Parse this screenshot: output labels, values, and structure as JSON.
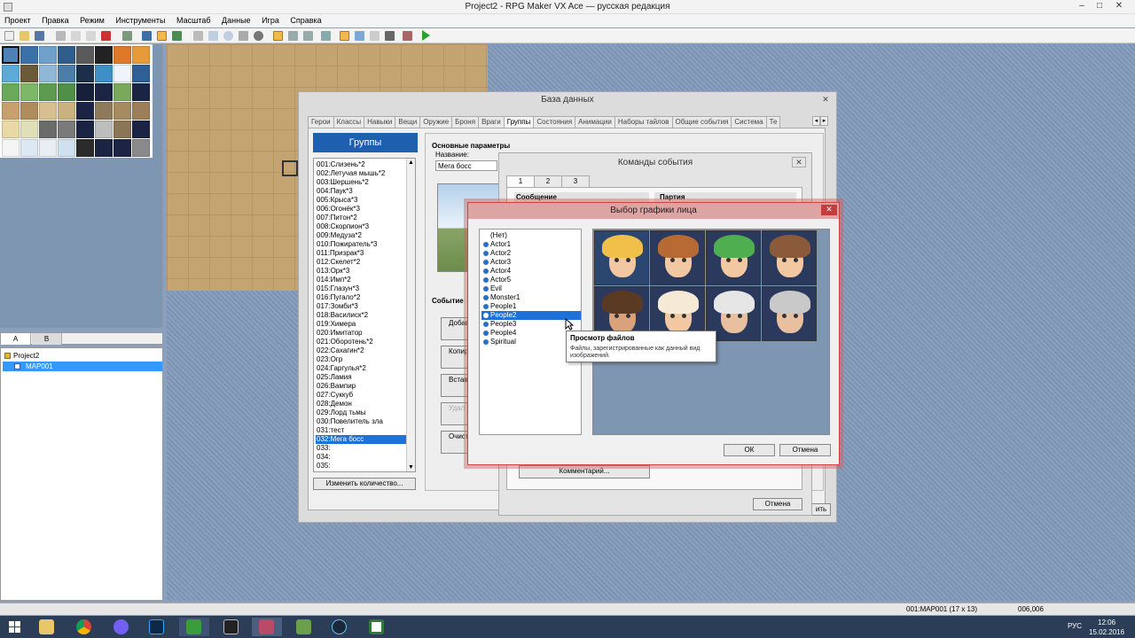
{
  "window": {
    "title": "Project2 - RPG Maker VX Ace — русская редакция",
    "minimize": "–",
    "maximize": "□",
    "close": "✕"
  },
  "menu": [
    "Проект",
    "Правка",
    "Режим",
    "Инструменты",
    "Масштаб",
    "Данные",
    "Игра",
    "Справка"
  ],
  "layer_tabs": [
    "A",
    "B"
  ],
  "tree": {
    "project": "Project2",
    "map": "MAP001"
  },
  "status": {
    "map": "001:MAP001 (17 x 13)",
    "coords": "006,006"
  },
  "taskbar": {
    "lang": "РУС",
    "time": "12:06",
    "date": "15.02.2016"
  },
  "database": {
    "title": "База данных",
    "tabs": [
      "Герои",
      "Классы",
      "Навыки",
      "Вещи",
      "Оружие",
      "Броня",
      "Враги",
      "Группы",
      "Состояния",
      "Анимации",
      "Наборы тайлов",
      "Общие события",
      "Система",
      "Те"
    ],
    "active_tab": "Группы",
    "groups_header": "Группы",
    "groups": [
      "001:Слизень*2",
      "002:Летучая мышь*2",
      "003:Шершень*2",
      "004:Паук*3",
      "005:Крыса*3",
      "006:Огонёк*3",
      "007:Питон*2",
      "008:Скорпион*3",
      "009:Медуза*2",
      "010:Пожиратель*3",
      "011:Призрак*3",
      "012:Скелет*2",
      "013:Орк*3",
      "014:Имп*2",
      "015:Глазун*3",
      "016:Пугало*2",
      "017:Зомби*3",
      "018:Василиск*2",
      "019:Химера",
      "020:Имитатор",
      "021:Оборотень*2",
      "022:Сахагин*2",
      "023:Огр",
      "024:Гаргулья*2",
      "025:Ламия",
      "026:Вампир",
      "027:Суккуб",
      "028:Демон",
      "029:Лорд тьмы",
      "030:Повелитель зла",
      "031:тест",
      "032:Мега босс",
      "033:",
      "034:",
      "035:"
    ],
    "selected_group": "032:Мега босс",
    "change_count_btn": "Изменить количество...",
    "basic_params": "Основные параметры",
    "name_label": "Название:",
    "name_value": "Мега босс",
    "event_label": "Событие",
    "side_buttons": [
      "Добав страни",
      "Копир страни",
      "Встав страни",
      "Удал страни",
      "Очист страни"
    ],
    "apply_fragment": "ить"
  },
  "event_commands": {
    "title": "Команды события",
    "tabs": [
      "1",
      "2",
      "3"
    ],
    "message_label": "Сообщение",
    "party_label": "Партия",
    "comment_btn": "Комментарий...",
    "cancel_btn": "Отмена"
  },
  "face_dialog": {
    "title": "Выбор графики лица",
    "files": [
      "(Нет)",
      "Actor1",
      "Actor2",
      "Actor3",
      "Actor4",
      "Actor5",
      "Evil",
      "Monster1",
      "People1",
      "People2",
      "People3",
      "People4",
      "Spiritual"
    ],
    "selected_file": "People2",
    "ok_btn": "ОК",
    "cancel_btn": "Отмена",
    "tooltip_title": "Просмотр файлов",
    "tooltip_desc": "Файлы, зарегистрированные как данный вид изображений."
  },
  "colors": {
    "accent": "#1e72d7",
    "dialog_border": "#c44444",
    "map_bg": "#7c93b4"
  }
}
